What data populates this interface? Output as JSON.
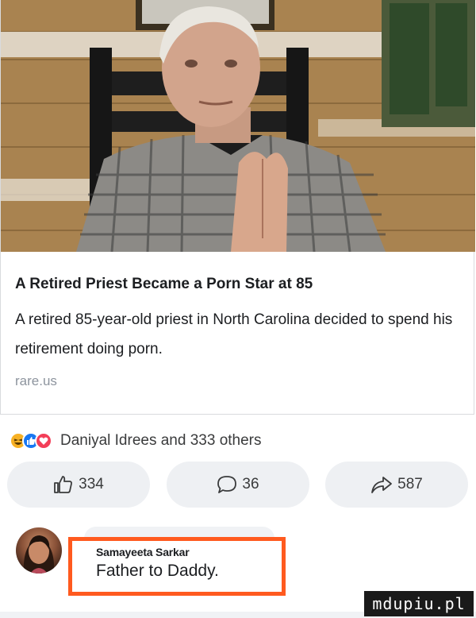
{
  "link_card": {
    "image_description": "elderly man in plaid shirt with hands pressed together",
    "title": "A Retired Priest Became a Porn Star at 85",
    "description": "A retired 85-year-old priest in North Carolina decided to spend his retirement doing porn.",
    "domain": "rare.us"
  },
  "reactions": {
    "icons": [
      "haha-icon",
      "like-icon",
      "love-icon"
    ],
    "summary": "Daniyal Idrees and 333 others"
  },
  "actions": {
    "like_count": "334",
    "comment_count": "36",
    "share_count": "587"
  },
  "comment": {
    "author": "Samayeeta Sarkar",
    "text": "Father to  Daddy."
  },
  "watermark": "mdupiu.pl",
  "colors": {
    "like_blue": "#1877f2",
    "love_red": "#f33e58",
    "haha_yellow": "#f7b125",
    "highlight_orange": "#ff5a1f"
  }
}
